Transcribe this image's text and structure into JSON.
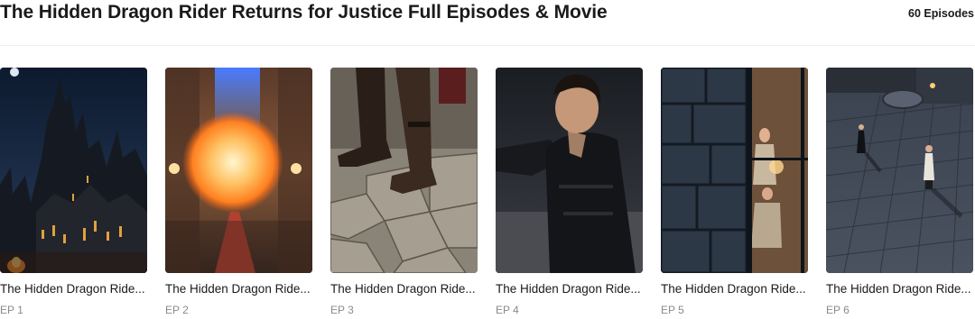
{
  "header": {
    "title": "The Hidden Dragon Rider Returns for Justice Full Episodes & Movie",
    "count": "60 Episodes"
  },
  "episodes": [
    {
      "title": "The Hidden Dragon Ride...",
      "ep": "EP 1",
      "thumb": "castle-night-thumbnail"
    },
    {
      "title": "The Hidden Dragon Ride...",
      "ep": "EP 2",
      "thumb": "fireball-corridor-thumbnail"
    },
    {
      "title": "The Hidden Dragon Ride...",
      "ep": "EP 3",
      "thumb": "boots-cobblestone-thumbnail"
    },
    {
      "title": "The Hidden Dragon Ride...",
      "ep": "EP 4",
      "thumb": "man-dark-armor-thumbnail"
    },
    {
      "title": "The Hidden Dragon Ride...",
      "ep": "EP 5",
      "thumb": "stone-window-women-thumbnail"
    },
    {
      "title": "The Hidden Dragon Ride...",
      "ep": "EP 6",
      "thumb": "courtyard-night-thumbnail"
    }
  ]
}
